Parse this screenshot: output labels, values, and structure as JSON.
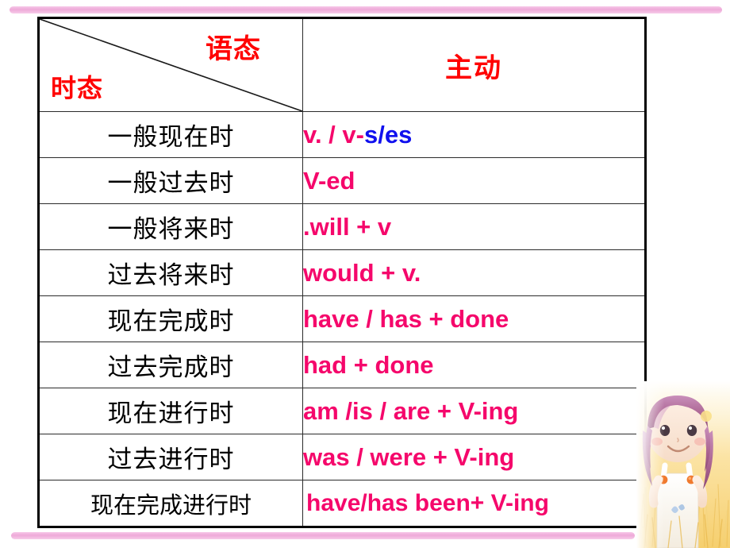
{
  "slide": {
    "decor": {
      "rule_color": "#eda4d6",
      "heart_color": "#e89ad8",
      "illustration_name": "cartoon-girl-in-wheat-field"
    }
  },
  "table": {
    "header": {
      "voice_label": "语态",
      "tense_label": "时态",
      "active_label": "主动",
      "header_color": "#ff0000"
    },
    "colors": {
      "tense_text": "#000000",
      "form_text": "#f5076b",
      "accent_blue": "#1010ee"
    },
    "rows": [
      {
        "tense": "一般现在时",
        "form_pre": "v. / v-",
        "form_blue": "s/es",
        "form_post": "",
        "form_full": "v. / v-s/es"
      },
      {
        "tense": "一般过去时",
        "form_pre": "V-ed",
        "form_blue": "",
        "form_post": "",
        "form_full": "V-ed"
      },
      {
        "tense": "一般将来时",
        "form_pre": ".will + v",
        "form_blue": "",
        "form_post": "",
        "form_full": ".will + v"
      },
      {
        "tense": "过去将来时",
        "form_pre": "would + v.",
        "form_blue": "",
        "form_post": "",
        "form_full": "would + v."
      },
      {
        "tense": "现在完成时",
        "form_pre": "have / has + done",
        "form_blue": "",
        "form_post": "",
        "form_full": "have / has + done"
      },
      {
        "tense": "过去完成时",
        "form_pre": "had + done",
        "form_blue": "",
        "form_post": "",
        "form_full": "had + done"
      },
      {
        "tense": "现在进行时",
        "form_pre": "am /is / are + V-ing",
        "form_blue": "",
        "form_post": "",
        "form_full": "am /is / are + V-ing"
      },
      {
        "tense": "过去进行时",
        "form_pre": "was / were + V-ing",
        "form_blue": "",
        "form_post": "",
        "form_full": "was / were + V-ing"
      },
      {
        "tense": "现在完成进行时",
        "form_pre": "have/has been+ V-ing",
        "form_blue": "",
        "form_post": "",
        "form_full": "have/has been+ V-ing"
      }
    ]
  }
}
